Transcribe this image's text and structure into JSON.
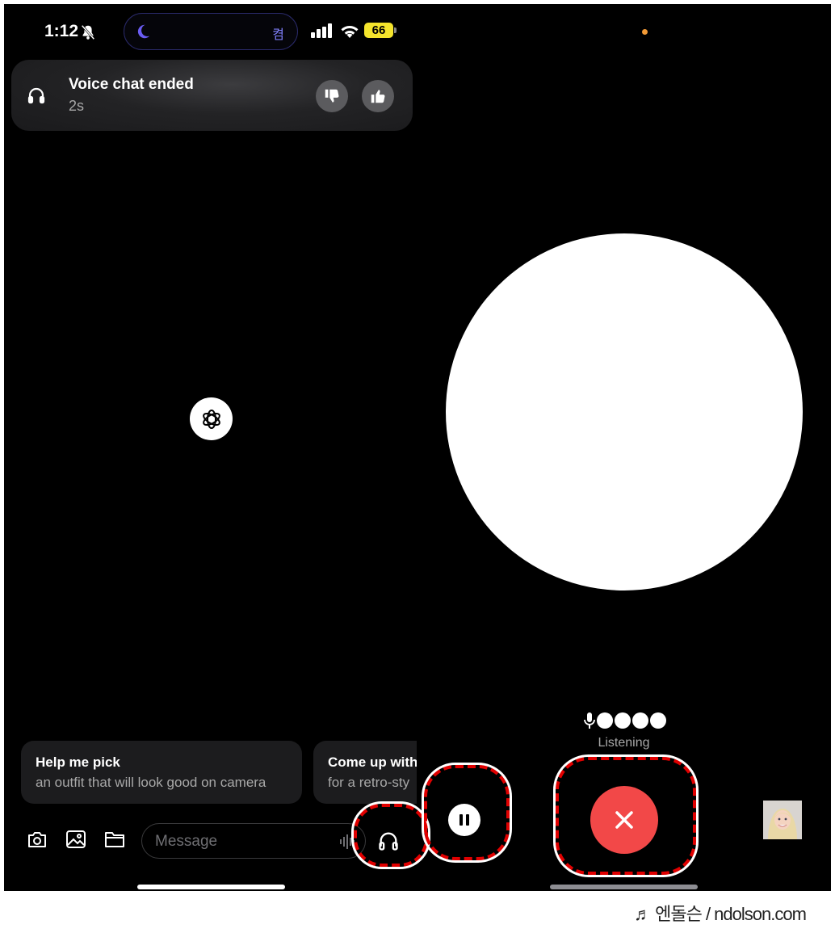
{
  "status_bar": {
    "time": "1:12",
    "island_text": "켬",
    "battery": "66"
  },
  "banner": {
    "title": "Voice chat ended",
    "duration": "2s"
  },
  "suggestions": [
    {
      "title": "Help me pick",
      "detail": "an outfit that will look good on camera"
    },
    {
      "title": "Come up with",
      "detail": "for a retro-sty"
    }
  ],
  "composer": {
    "placeholder": "Message"
  },
  "voice": {
    "status": "Listening",
    "accent": "#f24848"
  },
  "watermark": "♬ 엔돌슨 / ndolson.com"
}
